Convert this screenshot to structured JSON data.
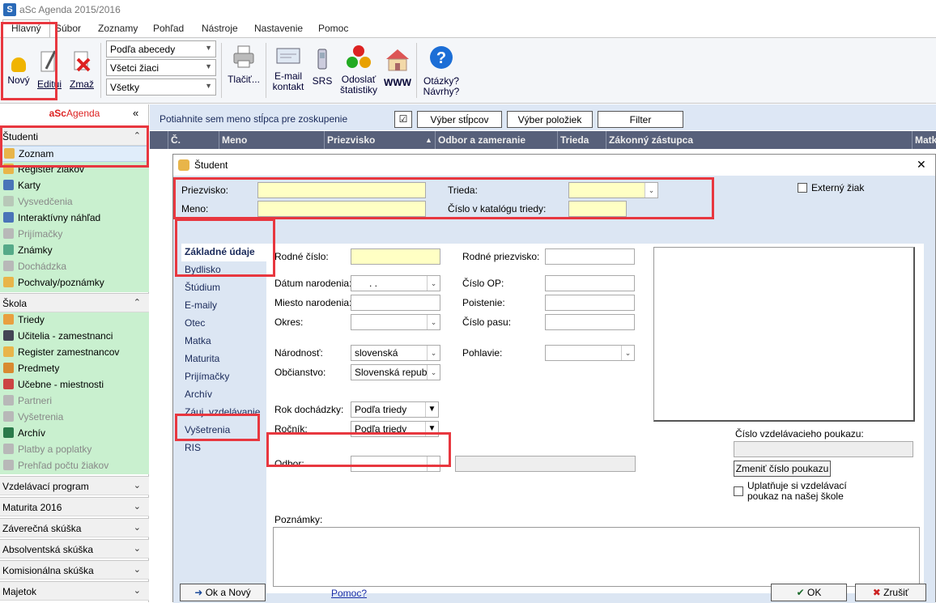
{
  "window": {
    "title": "aSc Agenda 2015/2016"
  },
  "menu": {
    "tabs": [
      "Hlavný",
      "Súbor",
      "Zoznamy",
      "Pohľad",
      "Nástroje",
      "Nastavenie",
      "Pomoc"
    ]
  },
  "ribbon": {
    "new_label": "Nový",
    "edit_label": "Editui",
    "delete_label": "Zmaž",
    "sort_select": "Podľa abecedy",
    "students_select": "Všetci žiaci",
    "filter_select": "Všetky",
    "print_label": "Tlačiť...",
    "email_label": [
      "E-mail",
      "kontakt"
    ],
    "srs_label": "SRS",
    "stats_label": [
      "Odoslať",
      "štatistiky"
    ],
    "www_label": "WWW",
    "questions_label": [
      "Otázky?",
      "Návrhy?"
    ]
  },
  "sidebar": {
    "brand_a": "aSc",
    "brand_b": "Agenda",
    "collapse_icon": "«",
    "sections": {
      "studenti": "Študenti",
      "skola": "Škola",
      "vzdelavaci": "Vzdelávací program",
      "maturita": "Maturita 2016",
      "zaverecna": "Záverečná skúška",
      "absolventska": "Absolventská skúška",
      "komisionalna": "Komisionálna skúška",
      "majetok": "Majetok"
    },
    "studenti_items": [
      "Zoznam",
      "Register žiakov",
      "Karty",
      "Vysvedčenia",
      "Interaktívny náhľad",
      "Prijímačky",
      "Známky",
      "Dochádzka",
      "Pochvaly/poznámky"
    ],
    "skola_items": [
      "Triedy",
      "Učitelia - zamestnanci",
      "Register zamestnancov",
      "Predmety",
      "Učebne - miestnosti",
      "Partneri",
      "Vyšetrenia",
      "Archív",
      "Platby a poplatky",
      "Prehľad počtu žiakov"
    ]
  },
  "grid": {
    "group_hint": "Potiahnite sem meno stĺpca pre zoskupenie",
    "columns_btn": "Výber stĺpcov",
    "items_btn": "Výber položiek",
    "filter_btn": "Filter",
    "columns": [
      "Č.",
      "Meno",
      "Priezvisko",
      "Odbor a zameranie",
      "Trieda",
      "Zákonný zástupca",
      "Matk"
    ]
  },
  "dialog": {
    "title": "Študent",
    "close": "✕",
    "surname_label": "Priezvisko:",
    "name_label": "Meno:",
    "class_label": "Trieda:",
    "catalog_label": "Číslo v katalógu triedy:",
    "external_label": "Externý žiak",
    "tabs": [
      "Základné údaje",
      "Bydlisko",
      "Štúdium",
      "E-maily",
      "Otec",
      "Matka",
      "Maturita",
      "Prijímačky",
      "Archív",
      "Záuj. vzdelávanie",
      "Vyšetrenia",
      "RIS"
    ],
    "fields": {
      "birth_number": "Rodné číslo:",
      "birth_date": "Dátum narodenia:",
      "birth_date_value": ". .",
      "birth_place": "Miesto narodenia:",
      "district": "Okres:",
      "maiden_name": "Rodné priezvisko:",
      "id_number": "Číslo OP:",
      "insurance": "Poistenie:",
      "passport": "Číslo pasu:",
      "nationality": "Národnosť:",
      "nationality_value": "slovenská",
      "citizenship": "Občianstvo:",
      "citizenship_value": "Slovenská republ",
      "gender": "Pohlavie:",
      "attendance_year": "Rok dochádzky:",
      "attendance_value": "Podľa triedy",
      "grade": "Ročník:",
      "grade_value": "Podľa triedy",
      "field": "Odbor:",
      "voucher_label": "Číslo vzdelávacieho poukazu:",
      "voucher_btn": "Zmeniť číslo poukazu",
      "voucher_check": [
        "Uplatňuje si vzdelávací",
        "poukaz na našej škole"
      ],
      "notes": "Poznámky:"
    },
    "ok_new": "Ok a Nový",
    "help": "Pomoc?",
    "ok": "OK",
    "cancel": "Zrušiť"
  },
  "colors": {
    "annotation_red": "#e8373f",
    "sidebar_green": "#c9f0cf",
    "header_dark": "#57607a",
    "required_yellow": "#ffffc4"
  }
}
